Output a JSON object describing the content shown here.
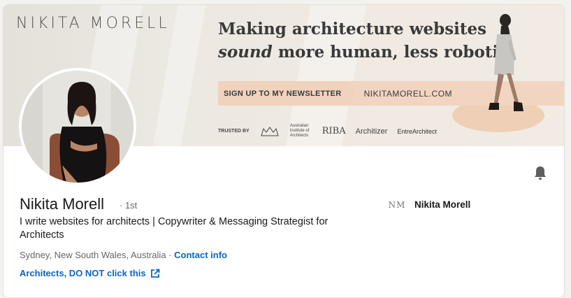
{
  "banner": {
    "brand": "NIKITA MORELL",
    "headline_line1": "Making architecture websites",
    "headline_italic": "sound",
    "headline_rest": "more human, less robotic.",
    "cta": "SIGN UP TO MY NEWSLETTER",
    "site": "NIKITAMORELL.COM",
    "trusted_label": "TRUSTED BY",
    "trusted_aia": "Australian Institute of Architects",
    "trusted_riba": "RIBA",
    "trusted_architizer": "Architizer",
    "trusted_entre": "EntreArchitect"
  },
  "profile": {
    "name": "Nikita Morell",
    "degree": "· 1st",
    "headline": "I write websites for architects | Copywriter & Messaging Strategist for Architects",
    "location": "Sydney, New South Wales, Australia",
    "separator": "·",
    "contact": "Contact info",
    "website_link": "Architects, DO NOT click this"
  },
  "company": {
    "logo_text": "NM",
    "name": "Nikita Morell"
  },
  "colors": {
    "link": "#0a66c2",
    "banner_accent": "#f2d5c1"
  },
  "icons": {
    "notify": "bell-icon",
    "external": "external-link-icon"
  }
}
